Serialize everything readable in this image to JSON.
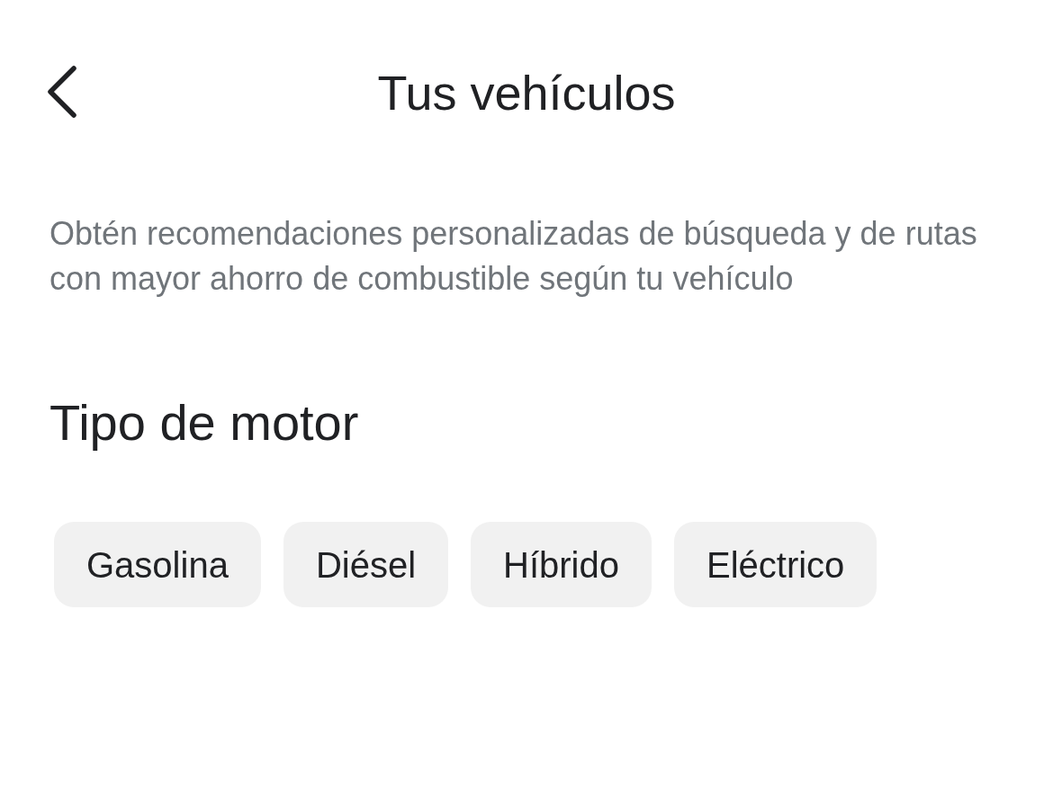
{
  "header": {
    "title": "Tus vehículos"
  },
  "description": "Obtén recomendaciones personalizadas de búsqueda y de rutas con mayor ahorro de combustible según tu vehículo",
  "engine_type": {
    "heading": "Tipo de motor",
    "options": [
      {
        "label": "Gasolina",
        "selected": false
      },
      {
        "label": "Diésel",
        "selected": false
      },
      {
        "label": "Híbrido",
        "selected": false
      },
      {
        "label": "Eléctrico",
        "selected": false
      }
    ]
  }
}
